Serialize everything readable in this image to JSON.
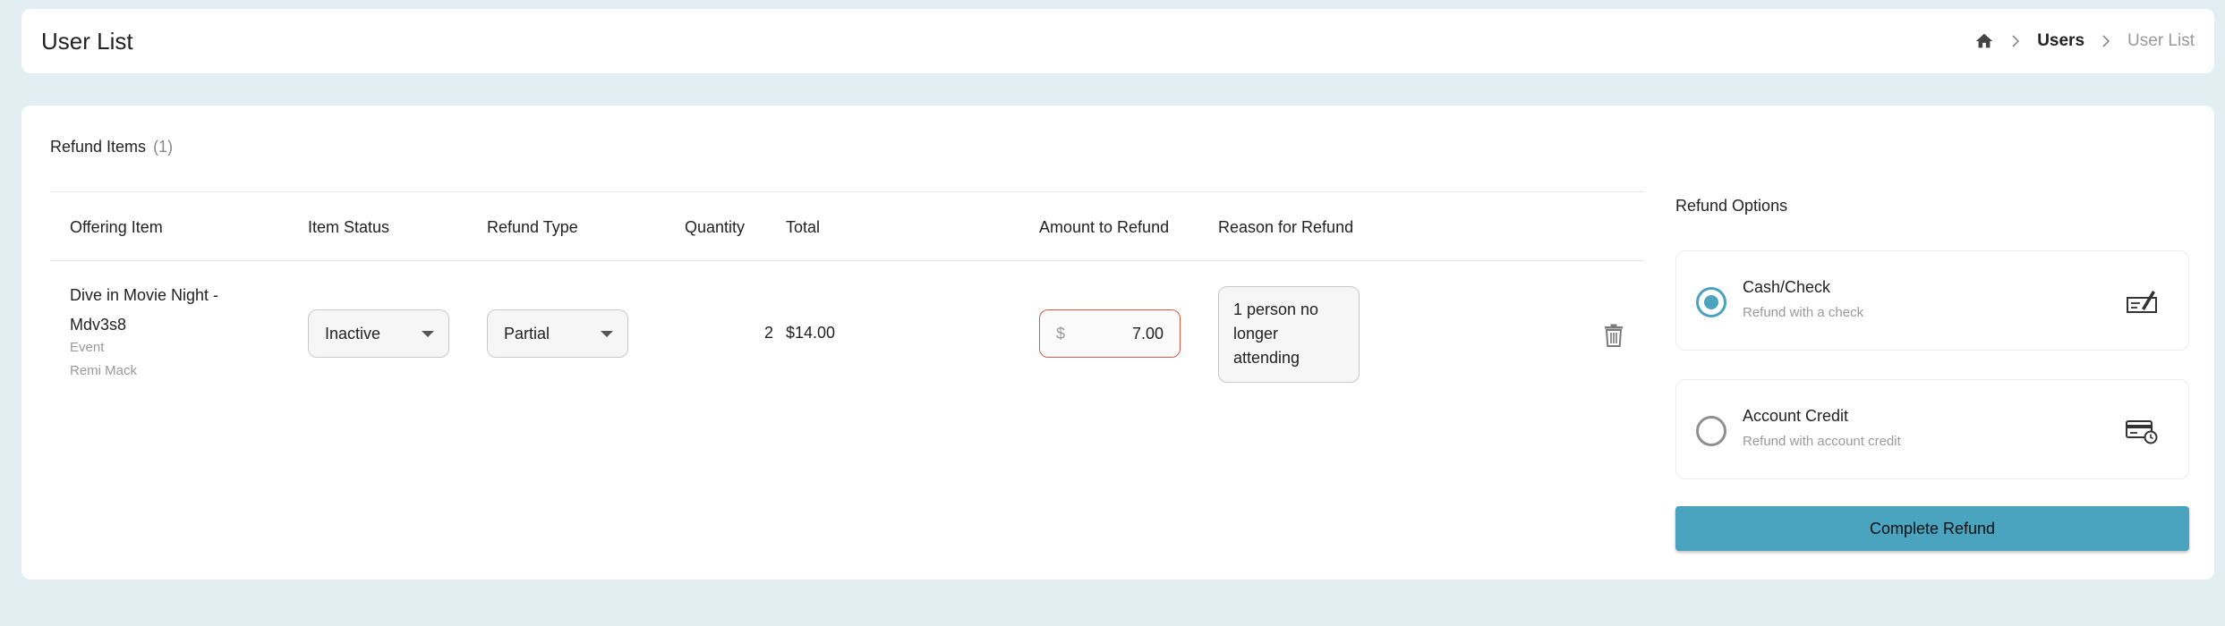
{
  "header": {
    "title": "User List",
    "breadcrumb": {
      "users": "Users",
      "current": "User List"
    }
  },
  "refund_items": {
    "title": "Refund Items",
    "count": "(1)",
    "columns": [
      "Offering Item",
      "Item Status",
      "Refund Type",
      "Quantity",
      "Total",
      "Amount to Refund",
      "Reason for Refund"
    ],
    "rows": [
      {
        "offering_name": "Dive in Movie Night - Mdv3s8",
        "offering_type": "Event",
        "offering_owner": "Remi Mack",
        "item_status": "Inactive",
        "refund_type": "Partial",
        "quantity": "2",
        "total": "$14.00",
        "currency_symbol": "$",
        "amount": "7.00",
        "reason": "1 person no longer attending"
      }
    ]
  },
  "refund_options": {
    "title": "Refund Options",
    "options": [
      {
        "label": "Cash/Check",
        "description": "Refund with a check",
        "selected": true,
        "icon": "check-payment-icon"
      },
      {
        "label": "Account Credit",
        "description": "Refund with account credit",
        "selected": false,
        "icon": "credit-card-clock-icon"
      }
    ],
    "complete_label": "Complete Refund"
  },
  "colors": {
    "accent": "#4aa3bf",
    "error_border": "#d9574a",
    "page_background": "#e3eef2"
  }
}
